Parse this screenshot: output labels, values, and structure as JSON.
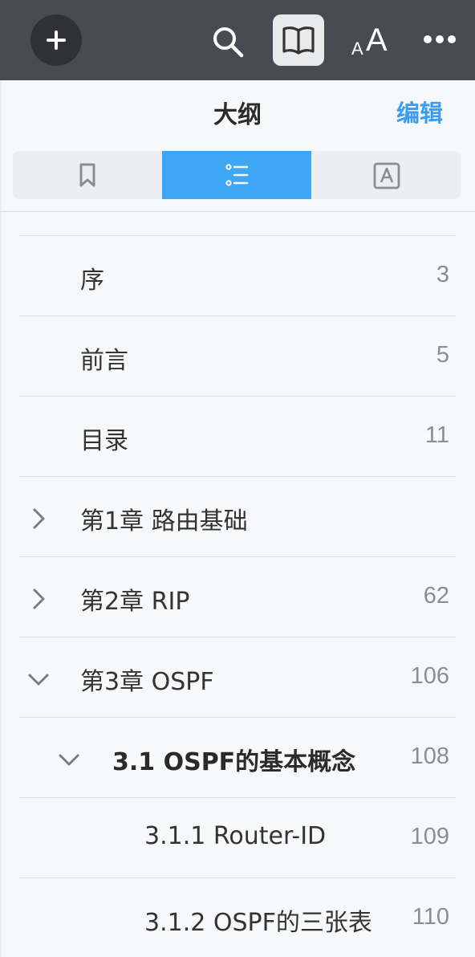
{
  "toolbar": {
    "icons": [
      "plus-icon",
      "search-icon",
      "book-icon",
      "font-size-icon",
      "more-icon"
    ],
    "font_small": "A",
    "font_big": "A"
  },
  "panel": {
    "title": "大纲",
    "edit_label": "编辑"
  },
  "tabs": [
    {
      "icon": "bookmark-icon",
      "active": false
    },
    {
      "icon": "outline-list-icon",
      "active": true
    },
    {
      "icon": "annotation-icon",
      "active": false
    }
  ],
  "colors": {
    "accent": "#3da6f5",
    "edit": "#3b9cf3",
    "toolbar": "#484b51"
  },
  "outline": [
    {
      "label": "序",
      "page": "3",
      "level": 0,
      "chevron": "none"
    },
    {
      "label": "前言",
      "page": "5",
      "level": 0,
      "chevron": "none"
    },
    {
      "label": "目录",
      "page": "11",
      "level": 0,
      "chevron": "none"
    },
    {
      "label": "第1章 路由基础",
      "page": "",
      "level": 0,
      "chevron": "collapsed"
    },
    {
      "label": "第2章 RIP",
      "page": "62",
      "level": 0,
      "chevron": "collapsed"
    },
    {
      "label": "第3章 OSPF",
      "page": "106",
      "level": 0,
      "chevron": "expanded"
    },
    {
      "label": "3.1 OSPF的基本概念",
      "page": "108",
      "level": 1,
      "chevron": "expanded",
      "bold": true
    },
    {
      "label": "3.1.1 Router-ID",
      "page": "109",
      "level": 2,
      "chevron": "none"
    },
    {
      "label": "3.1.2 OSPF的三张表",
      "page": "110",
      "level": 2,
      "chevron": "none"
    }
  ]
}
